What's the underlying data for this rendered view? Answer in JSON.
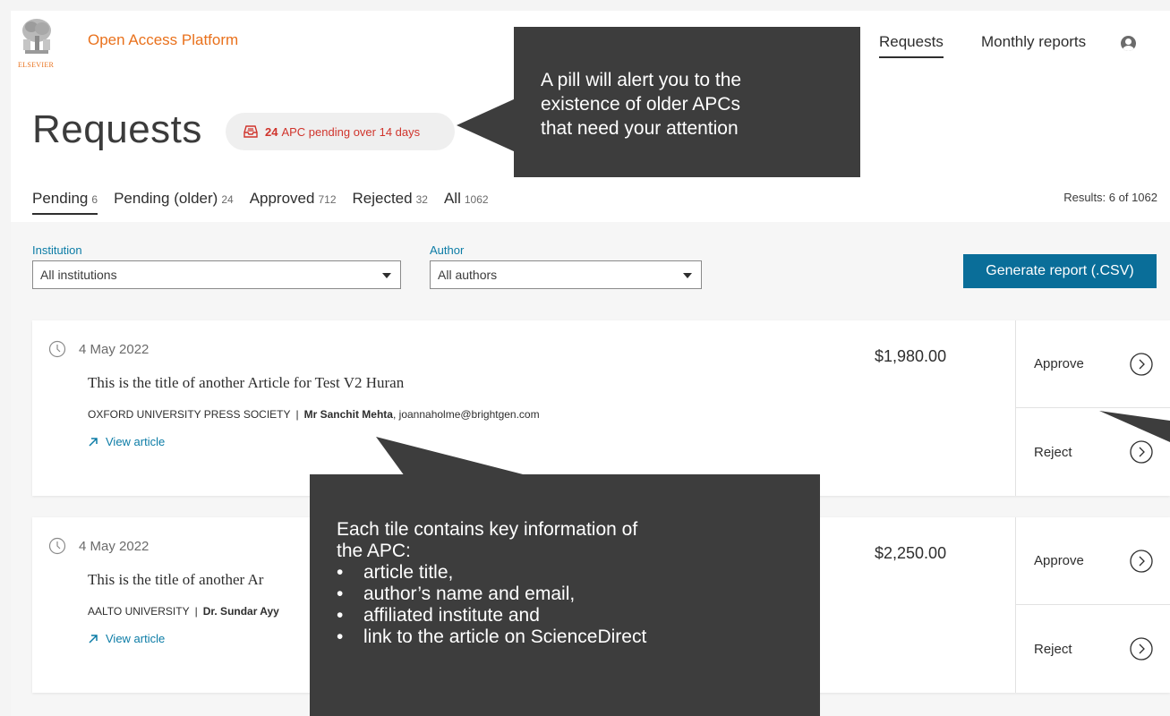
{
  "header": {
    "brand": "Open Access Platform",
    "logo_word": "ELSEVIER",
    "nav": {
      "requests": "Requests",
      "monthly_reports": "Monthly reports"
    },
    "accent_color": "#e9711c"
  },
  "page": {
    "title": "Requests",
    "pill": {
      "count": "24",
      "text": "APC pending over 14 days",
      "icon": "inbox-alert-icon",
      "color": "#d0342c"
    }
  },
  "tabs": [
    {
      "label": "Pending",
      "count": "6"
    },
    {
      "label": "Pending (older)",
      "count": "24"
    },
    {
      "label": "Approved",
      "count": "712"
    },
    {
      "label": "Rejected",
      "count": "32"
    },
    {
      "label": "All",
      "count": "1062"
    }
  ],
  "results": "Results: 6 of 1062",
  "filters": {
    "institution": {
      "label": "Institution",
      "value": "All institutions"
    },
    "author": {
      "label": "Author",
      "value": "All authors"
    }
  },
  "generate_button": "Generate report (.CSV)",
  "tiles": [
    {
      "date": "4 May 2022",
      "title": "This is the title of another Article for Test V2 Huran",
      "institution": "OXFORD UNIVERSITY PRESS SOCIETY",
      "separator": "|",
      "author": "Mr Sanchit Mehta",
      "email": ", joannaholme@brightgen.com",
      "view_link": "View article",
      "price": "$1,980.00",
      "approve": "Approve",
      "reject": "Reject"
    },
    {
      "date": "4 May 2022",
      "title": "This is the title of another Ar",
      "institution": "AALTO UNIVERSITY",
      "separator": "|",
      "author": "Dr. Sundar Ayy",
      "email": "",
      "view_link": "View article",
      "price": "$2,250.00",
      "approve": "Approve",
      "reject": "Reject"
    }
  ],
  "callouts": {
    "pill_note": [
      "A pill will alert you to the",
      "existence of older APCs",
      "that need your attention"
    ],
    "tile_note": {
      "intro": [
        "Each tile contains key information of",
        "the APC:"
      ],
      "bullets": [
        "article title,",
        "author’s name and email,",
        "affiliated institute and",
        "link to the article on ScienceDirect"
      ]
    }
  }
}
